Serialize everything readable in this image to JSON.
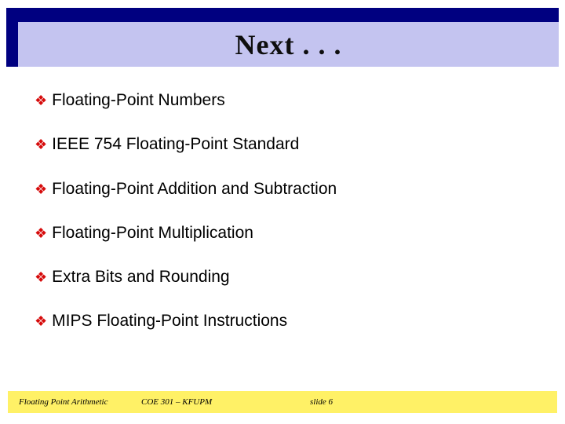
{
  "title": "Next . . .",
  "bullets": [
    "Floating-Point Numbers",
    "IEEE 754 Floating-Point Standard",
    "Floating-Point Addition and Subtraction",
    "Floating-Point Multiplication",
    "Extra Bits and Rounding",
    "MIPS Floating-Point Instructions"
  ],
  "footer": {
    "topic": "Floating Point Arithmetic",
    "course": "COE 301 – KFUPM",
    "page": "slide 6"
  },
  "bullet_glyph": "❖"
}
